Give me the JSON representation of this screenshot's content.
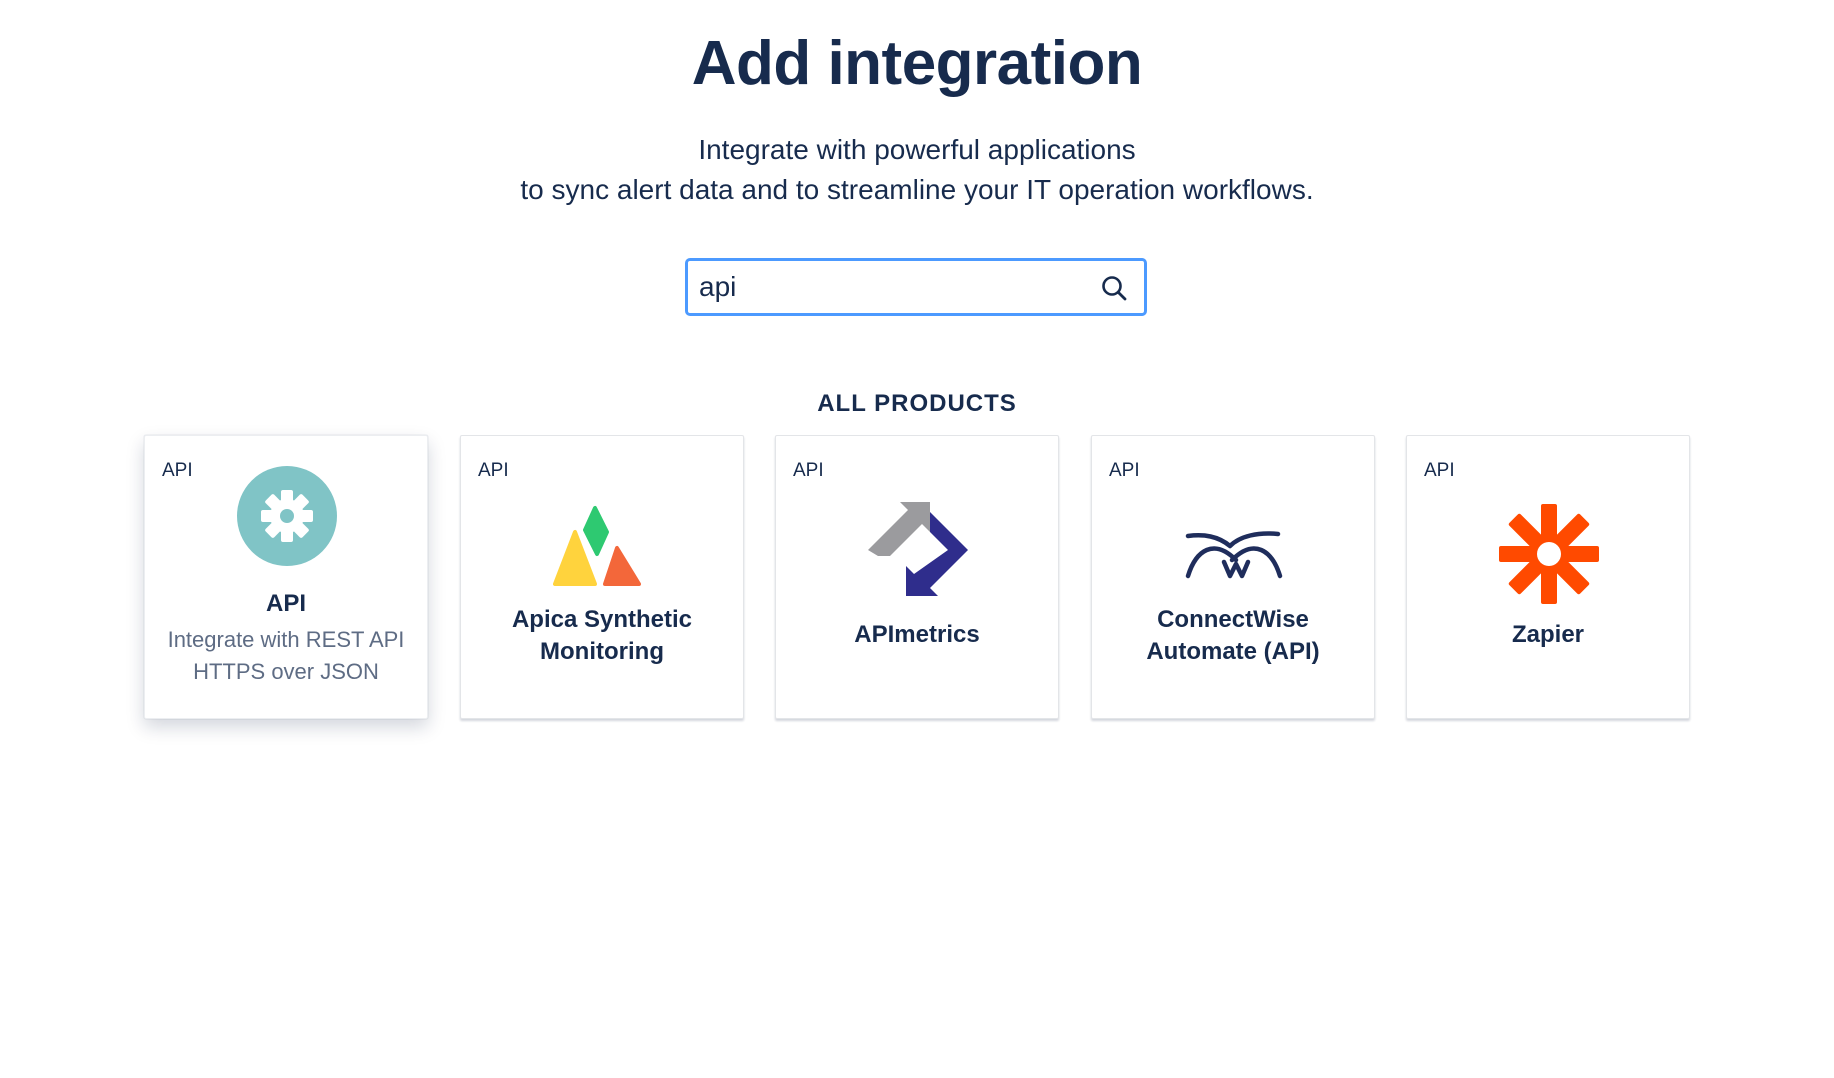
{
  "header": {
    "title": "Add integration",
    "subtitle_line1": "Integrate with powerful applications",
    "subtitle_line2": "to sync alert data and to streamline your IT operation workflows."
  },
  "search": {
    "value": "api",
    "icon": "search-icon"
  },
  "section": {
    "heading": "ALL PRODUCTS"
  },
  "cards": [
    {
      "tag": "API",
      "name": "API",
      "description": "Integrate with REST API HTTPS over JSON",
      "icon": "gear-icon",
      "color": "#80c4c6"
    },
    {
      "tag": "API",
      "name": "Apica Synthetic Monitoring",
      "description": "",
      "icon": "apica-logo-icon"
    },
    {
      "tag": "API",
      "name": "APImetrics",
      "description": "",
      "icon": "apimetrics-logo-icon"
    },
    {
      "tag": "API",
      "name": "ConnectWise Automate (API)",
      "description": "",
      "icon": "connectwise-logo-icon"
    },
    {
      "tag": "API",
      "name": "Zapier",
      "description": "",
      "icon": "zapier-logo-icon",
      "color": "#ff4a00"
    }
  ],
  "colors": {
    "text_primary": "#172b4d",
    "text_secondary": "#5e6c84",
    "focus_border": "#4c9aff"
  }
}
